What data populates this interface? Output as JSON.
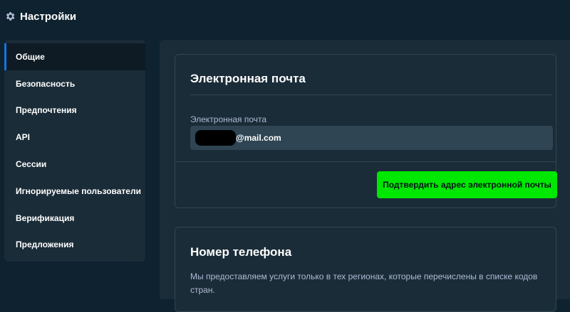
{
  "header": {
    "title": "Настройки",
    "icon": "gear-icon"
  },
  "sidebar": {
    "items": [
      {
        "label": "Общие",
        "active": true
      },
      {
        "label": "Безопасность",
        "active": false
      },
      {
        "label": "Предпочтения",
        "active": false
      },
      {
        "label": "API",
        "active": false
      },
      {
        "label": "Сессии",
        "active": false
      },
      {
        "label": "Игнорируемые пользователи",
        "active": false
      },
      {
        "label": "Верификация",
        "active": false
      },
      {
        "label": "Предложения",
        "active": false
      }
    ]
  },
  "email_section": {
    "title": "Электронная почта",
    "field_label": "Электронная почта",
    "field_value": "@mail.com",
    "confirm_label": "Подтвердить адрес электронной почты"
  },
  "phone_section": {
    "title": "Номер телефона",
    "description": "Мы предоставляем услуги только в тех регионах, которые перечислены в списке кодов стран."
  },
  "colors": {
    "background": "#0e2230",
    "panel": "#1a2c38",
    "input": "#2f4553",
    "accent_active": "#1475e1",
    "confirm_button": "#00e701"
  }
}
